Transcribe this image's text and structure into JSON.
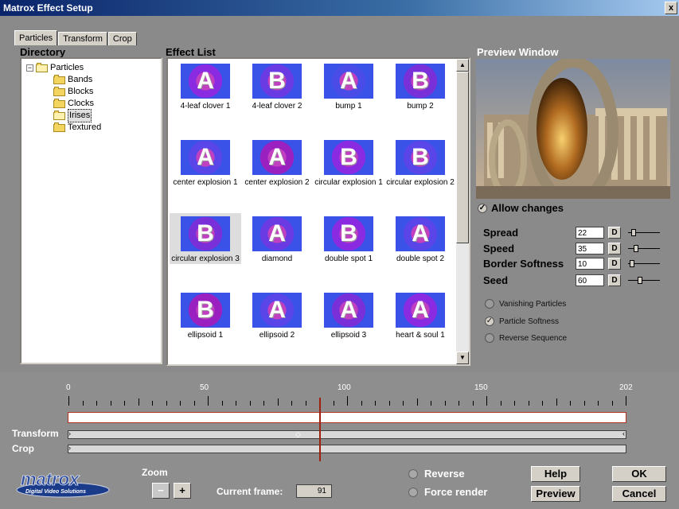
{
  "window": {
    "title": "Matrox Effect Setup",
    "close": "x"
  },
  "tabs": [
    {
      "label": "Particles"
    },
    {
      "label": "Transform"
    },
    {
      "label": "Crop"
    }
  ],
  "directory": {
    "heading": "Directory",
    "root": "Particles",
    "items": [
      "Bands",
      "Blocks",
      "Clocks",
      "Irises",
      "Textured"
    ],
    "selected": "Irises"
  },
  "effect_list": {
    "heading": "Effect List",
    "items": [
      {
        "label": "4-leaf clover 1",
        "letter": "A",
        "accent": "#8a2be2"
      },
      {
        "label": "4-leaf clover 2",
        "letter": "B",
        "accent": "#6a3be2"
      },
      {
        "label": "bump 1",
        "letter": "A",
        "accent": "#4a4ce8"
      },
      {
        "label": "bump 2",
        "letter": "B",
        "accent": "#7a30d8"
      },
      {
        "label": "center explosion 1",
        "letter": "A",
        "accent": "#5a46e8"
      },
      {
        "label": "center explosion 2",
        "letter": "A",
        "accent": "#9a20c0"
      },
      {
        "label": "circular explosion 1",
        "letter": "B",
        "accent": "#8a2be2"
      },
      {
        "label": "circular explosion 2",
        "letter": "B",
        "accent": "#5a46e8"
      },
      {
        "label": "circular explosion 3",
        "letter": "B",
        "accent": "#7a30d8"
      },
      {
        "label": "diamond",
        "letter": "A",
        "accent": "#6a3be2"
      },
      {
        "label": "double spot 1",
        "letter": "B",
        "accent": "#8a2be2"
      },
      {
        "label": "double spot 2",
        "letter": "A",
        "accent": "#5a46e8"
      },
      {
        "label": "ellipsoid 1",
        "letter": "B",
        "accent": "#9a20c0"
      },
      {
        "label": "ellipsoid 2",
        "letter": "A",
        "accent": "#5a46e8"
      },
      {
        "label": "ellipsoid 3",
        "letter": "A",
        "accent": "#7a30d8"
      },
      {
        "label": "heart & soul 1",
        "letter": "A",
        "accent": "#8a2be2"
      }
    ],
    "highlighted": "circular explosion 3"
  },
  "preview": {
    "heading": "Preview Window"
  },
  "allow_changes": {
    "label": "Allow changes",
    "checked": true
  },
  "params": [
    {
      "label": "Spread",
      "value": "22",
      "d": "D",
      "level": 0.11
    },
    {
      "label": "Speed",
      "value": "35",
      "d": "D",
      "level": 0.17
    },
    {
      "label": "Border Softness",
      "value": "10",
      "d": "D",
      "level": 0.05
    },
    {
      "label": "Seed",
      "value": "60",
      "d": "D",
      "level": 0.3
    }
  ],
  "options": [
    {
      "label": "Vanishing Particles",
      "checked": false
    },
    {
      "label": "Particle Softness",
      "checked": true
    },
    {
      "label": "Reverse Sequence",
      "checked": false
    }
  ],
  "timeline": {
    "ruler_labels": [
      "0",
      "50",
      "100",
      "150",
      "202"
    ],
    "max_frame": 202,
    "rows": [
      "Transform",
      "Crop"
    ],
    "current_frame_label": "Current frame:",
    "current_frame": "91"
  },
  "zoom": {
    "label": "Zoom",
    "minus": "−",
    "plus": "+"
  },
  "render_options": {
    "reverse": "Reverse",
    "force_render": "Force render"
  },
  "buttons": {
    "help": "Help",
    "preview": "Preview",
    "ok": "OK",
    "cancel": "Cancel"
  },
  "logo": {
    "brand": "matrox",
    "tagline": "Digital Video Solutions"
  }
}
